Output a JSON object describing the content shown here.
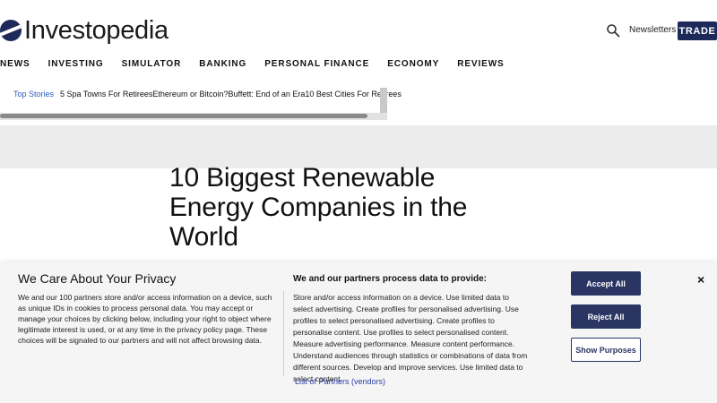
{
  "header": {
    "logo_text": "Investopedia",
    "newsletters_label": "Newsletters",
    "trade_label": "TRADE"
  },
  "nav": {
    "items": [
      "NEWS",
      "INVESTING",
      "SIMULATOR",
      "BANKING",
      "PERSONAL FINANCE",
      "ECONOMY",
      "REVIEWS"
    ]
  },
  "ticker": {
    "label": "Top Stories",
    "items": [
      "5 Spa Towns For Retirees",
      "Ethereum or Bitcoin?",
      "Buffett: End of an Era",
      "10 Best Cities For Retirees"
    ]
  },
  "article": {
    "title": "10 Biggest Renewable Energy Companies in the World"
  },
  "privacy": {
    "title": "We Care About Your Privacy",
    "body": "We and our 100 partners store and/or access information on a device, such as unique IDs in cookies to process personal data. You may accept or manage your choices by clicking below, including your right to object where legitimate interest is used, or at any time in the privacy policy page. These choices will be signaled to our partners and will not affect browsing data.",
    "partners_heading": "We and our partners process data to provide:",
    "partners_list": "Store and/or access information on a device. Use limited data to select advertising. Create profiles for personalised advertising. Use profiles to select personalised advertising. Create profiles to personalise content. Use profiles to select personalised content. Measure advertising performance. Measure content performance. Understand audiences through statistics or combinations of data from different sources. Develop and improve services. Use limited data to select content.",
    "partners_link": "List of Partners (vendors)",
    "accept_label": "Accept All",
    "reject_label": "Reject All",
    "purposes_label": "Show Purposes",
    "close_label": "×"
  },
  "colors": {
    "brand_navy": "#1d2a59",
    "button_navy": "#2a3563",
    "link_blue": "#2a5bbf"
  },
  "icons": {
    "search": "search-icon",
    "logo": "investopedia-logo-icon",
    "close": "close-icon"
  }
}
